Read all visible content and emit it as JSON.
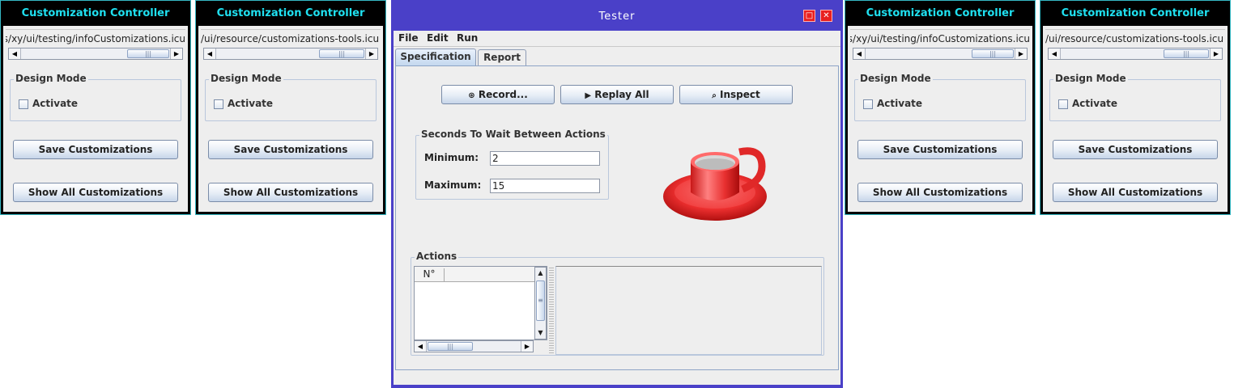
{
  "palettes": [
    {
      "title": "Customization Controller",
      "path": "ss/xy/ui/testing/infoCustomizations.icu",
      "group_title": "Design Mode",
      "checkbox_label": "Activate",
      "save_label": "Save Customizations",
      "show_all_label": "Show All Customizations"
    },
    {
      "title": "Customization Controller",
      "path": "/ui/resource/customizations-tools.icu",
      "group_title": "Design Mode",
      "checkbox_label": "Activate",
      "save_label": "Save Customizations",
      "show_all_label": "Show All Customizations"
    },
    {
      "title": "Customization Controller",
      "path": "ss/xy/ui/testing/infoCustomizations.icu",
      "group_title": "Design Mode",
      "checkbox_label": "Activate",
      "save_label": "Save Customizations",
      "show_all_label": "Show All Customizations"
    },
    {
      "title": "Customization Controller",
      "path": "/ui/resource/customizations-tools.icu",
      "group_title": "Design Mode",
      "checkbox_label": "Activate",
      "save_label": "Save Customizations",
      "show_all_label": "Show All Customizations"
    }
  ],
  "tester": {
    "title": "Tester",
    "menu": {
      "file": "File",
      "edit": "Edit",
      "run": "Run"
    },
    "tabs": {
      "specification": "Specification",
      "report": "Report"
    },
    "buttons": {
      "record": "Record...",
      "replay_all": "Replay All",
      "inspect": "Inspect"
    },
    "wait_group": {
      "title": "Seconds To Wait Between Actions",
      "minimum_label": "Minimum:",
      "minimum_value": "2",
      "maximum_label": "Maximum:",
      "maximum_value": "15"
    },
    "actions": {
      "title": "Actions",
      "column_number": "N°"
    },
    "icons": {
      "logo": "coffee-cup-icon",
      "close": "close-icon",
      "maximize": "maximize-icon"
    }
  }
}
